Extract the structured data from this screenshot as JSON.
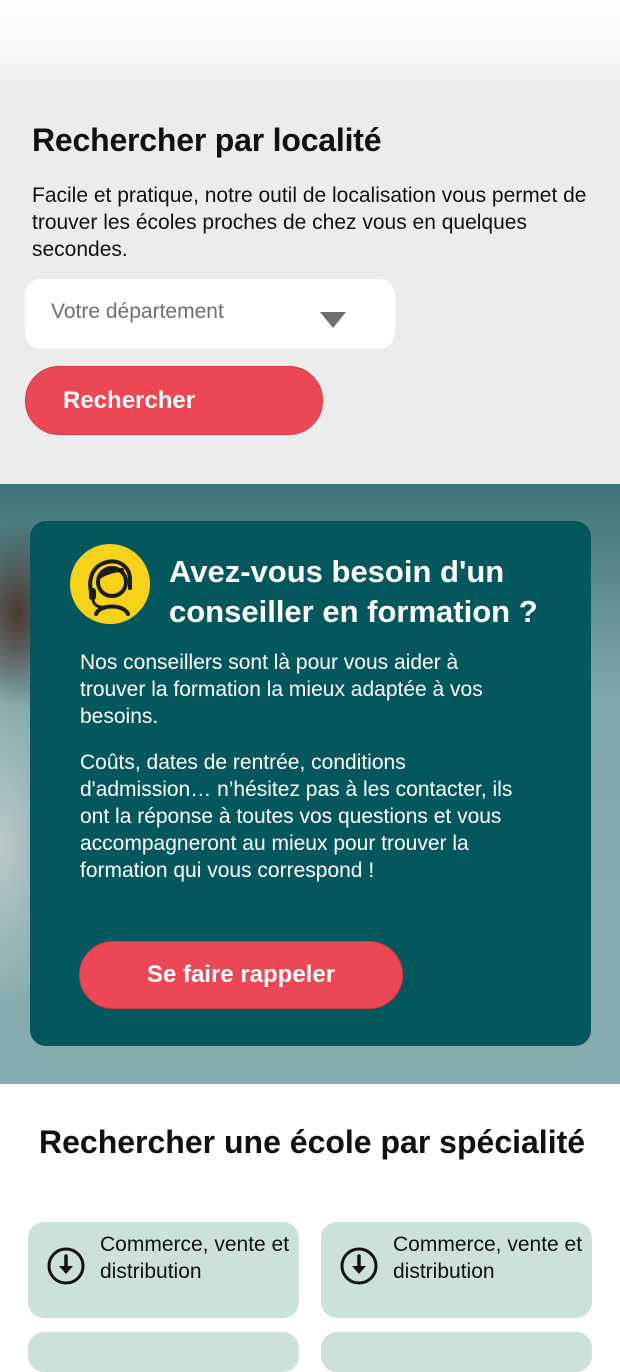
{
  "locality_search": {
    "title": "Rechercher par localité",
    "description": "Facile et pratique, notre outil de localisation vous permet de trouver les écoles proches de chez vous en quelques secondes.",
    "department_placeholder": "Votre département",
    "search_button": "Rechercher"
  },
  "counselor": {
    "title": "Avez-vous besoin d'un conseiller en formation ?",
    "paragraph_1": "Nos conseillers sont là pour vous aider à trouver la formation la mieux adaptée à vos besoins.",
    "paragraph_2": "Coûts, dates de rentrée, conditions d'admission… n’hésitez pas à les contacter, ils ont la réponse à toutes vos questions et vous accompagneront au mieux pour trouver la formation qui vous correspond !",
    "callback_button": "Se faire rappeler",
    "icon": "headset-advisor-icon"
  },
  "specialty_search": {
    "title": "Rechercher une école par spécialité",
    "items": [
      {
        "label": "Commerce, vente et distribution",
        "icon": "download-circle-icon"
      },
      {
        "label": "Commerce, vente et distribution",
        "icon": "download-circle-icon"
      }
    ]
  },
  "colors": {
    "accent_red": "#ec4755",
    "card_teal": "#05575e",
    "chip_green": "#cde1dc",
    "icon_yellow": "#f7d21b"
  }
}
